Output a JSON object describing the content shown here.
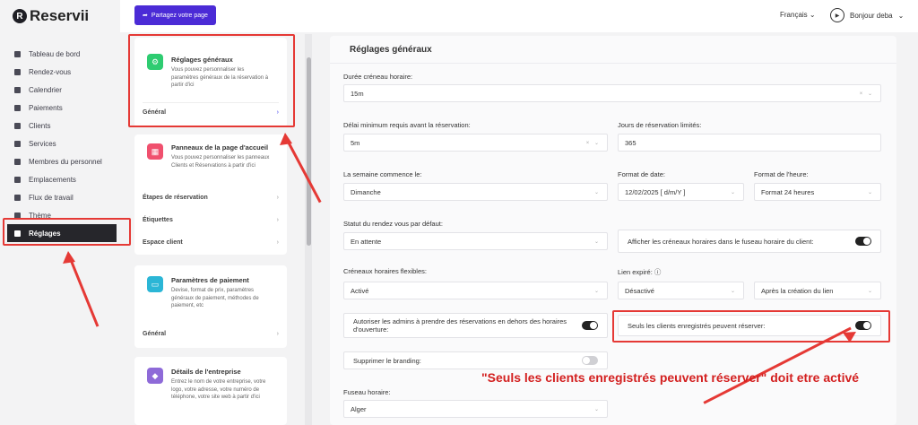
{
  "app": {
    "logo_letter": "R",
    "name": "Reservii"
  },
  "sidebar": {
    "items": [
      {
        "label": "Tableau de bord"
      },
      {
        "label": "Rendez-vous"
      },
      {
        "label": "Calendrier"
      },
      {
        "label": "Paiements"
      },
      {
        "label": "Clients"
      },
      {
        "label": "Services"
      },
      {
        "label": "Membres du personnel"
      },
      {
        "label": "Emplacements"
      },
      {
        "label": "Flux de travail"
      },
      {
        "label": "Thème"
      },
      {
        "label": "Réglages",
        "active": true
      }
    ]
  },
  "topbar": {
    "share_label": "Partagez votre page",
    "language": "Français",
    "greeting": "Bonjour deba",
    "avatar_text": "deba"
  },
  "panels": {
    "general": {
      "title": "Réglages généraux",
      "desc": "Vous pouvez personnaliser les paramètres généraux de la réservation à partir d'ici",
      "link": "Général"
    },
    "homepage": {
      "title": "Panneaux de la page d'accueil",
      "desc": "Vous pouvez personnaliser les panneaux Clients et Réservations à partir d'ici",
      "links": [
        "Étapes de réservation",
        "Étiquettes",
        "Espace client"
      ]
    },
    "payment": {
      "title": "Paramètres de paiement",
      "desc": "Devise, format de prix, paramètres généraux de paiement, méthodes de paiement, etc",
      "link": "Général"
    },
    "company": {
      "title": "Détails de l'entreprise",
      "desc": "Entrez le nom de votre entreprise, votre logo, votre adresse, votre numéro de téléphone, votre site web à partir d'ici"
    }
  },
  "main": {
    "title": "Réglages généraux",
    "slot_duration": {
      "label": "Durée créneau horaire:",
      "value": "15m"
    },
    "min_delay": {
      "label": "Délai minimum requis avant la réservation:",
      "value": "5m"
    },
    "limit_days": {
      "label": "Jours de réservation limités:",
      "value": "365"
    },
    "week_start": {
      "label": "La semaine commence le:",
      "value": "Dimanche"
    },
    "date_format": {
      "label": "Format de date:",
      "value": "12/02/2025 [ d/m/Y ]"
    },
    "time_format": {
      "label": "Format de l'heure:",
      "value": "Format 24 heures"
    },
    "default_status": {
      "label": "Statut du rendez vous par défaut:",
      "value": "En attente"
    },
    "client_tz_toggle": {
      "label": "Afficher les créneaux horaires dans le fuseau horaire du client:",
      "on": true
    },
    "flex_slots": {
      "label": "Créneaux horaires flexibles:",
      "value": "Activé"
    },
    "expired_link": {
      "label": "Lien expiré:",
      "value": "Désactivé",
      "after": "Après la création du lien"
    },
    "admin_outside": {
      "label": "Autoriser les admins à prendre des réservations en dehors des horaires d'ouverture:",
      "on": true
    },
    "registered_only": {
      "label": "Seuls les clients enregistrés peuvent réserver:",
      "on": true
    },
    "remove_branding": {
      "label": "Supprimer le branding:",
      "on": false
    },
    "timezone": {
      "label": "Fuseau horaire:",
      "value": "Alger"
    }
  },
  "annotation": "\"Seuls les clients enregistrés peuvent réserver\" doit etre activé",
  "colors": {
    "accent": "#4b2bd6",
    "annotation": "#e53935",
    "active_nav": "#26262b"
  }
}
